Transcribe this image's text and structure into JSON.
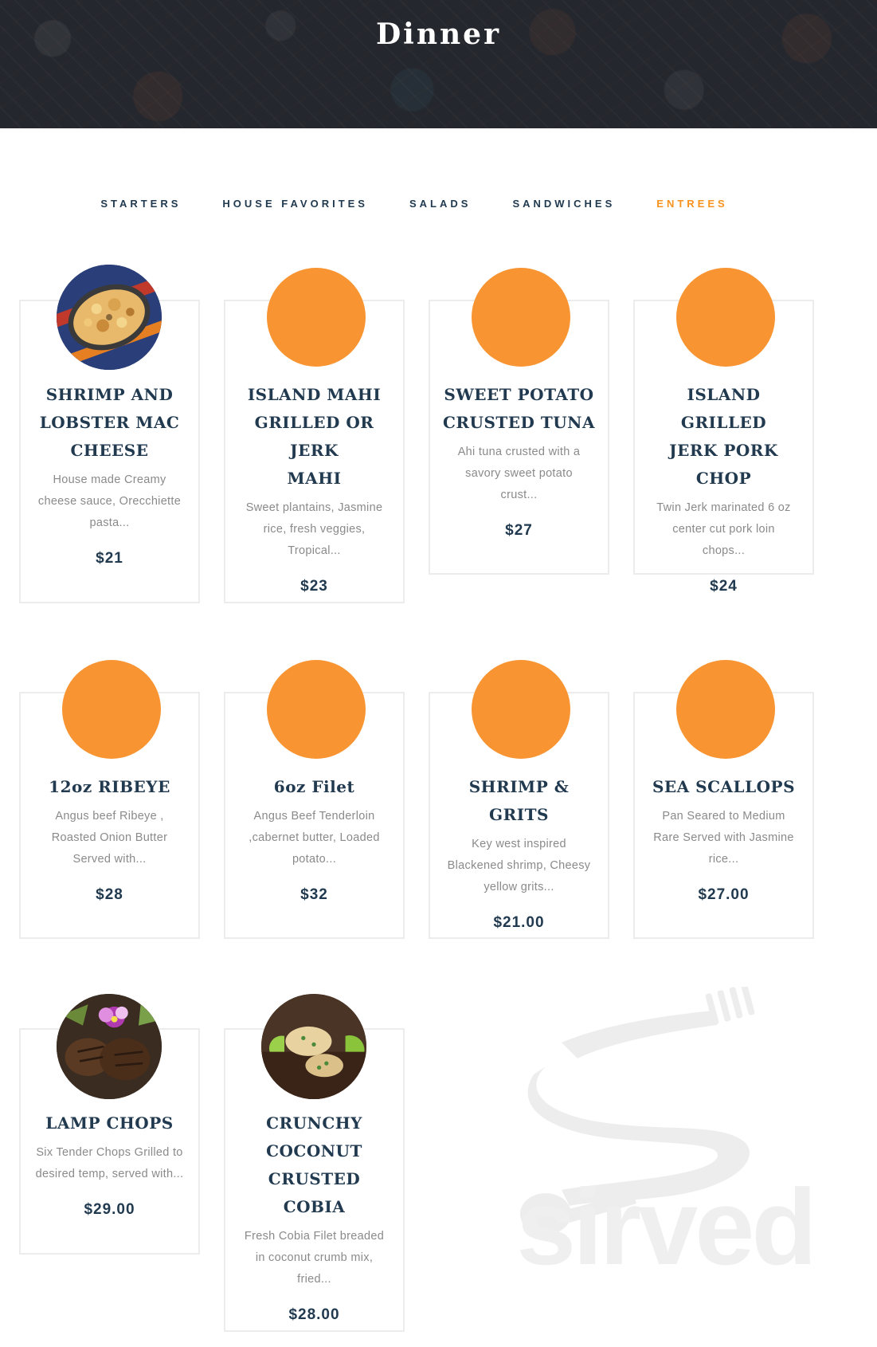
{
  "header": {
    "title": "Dinner"
  },
  "tabs": [
    {
      "label": "STARTERS",
      "active": false
    },
    {
      "label": "HOUSE FAVORITES",
      "active": false
    },
    {
      "label": "SALADS",
      "active": false
    },
    {
      "label": "SANDWICHES",
      "active": false
    },
    {
      "label": "ENTREES",
      "active": true
    }
  ],
  "colors": {
    "accent": "#f7931e",
    "placeholder": "#f89431",
    "text": "#213a4f",
    "muted": "#8a8a8a"
  },
  "items": [
    {
      "title_lines": [
        "SHRIMP AND",
        "LOBSTER MAC",
        "CHEESE"
      ],
      "desc_lines": [
        "House made Creamy",
        "cheese sauce, Orecchiette",
        "pasta..."
      ],
      "price": "$21",
      "image": "mac-cheese-photo"
    },
    {
      "title_lines": [
        "ISLAND MAHI",
        "GRILLED OR JERK",
        "MAHI"
      ],
      "desc_lines": [
        "Sweet plantains, Jasmine",
        "rice, fresh veggies,",
        "Tropical..."
      ],
      "price": "$23",
      "image": "placeholder"
    },
    {
      "title_lines": [
        "SWEET POTATO",
        "CRUSTED TUNA"
      ],
      "desc_lines": [
        "Ahi tuna crusted with a",
        "savory sweet potato",
        "crust..."
      ],
      "price": "$27",
      "image": "placeholder"
    },
    {
      "title_lines": [
        "ISLAND GRILLED",
        "JERK PORK CHOP"
      ],
      "desc_lines": [
        "Twin Jerk marinated 6 oz",
        "center cut pork loin",
        "chops..."
      ],
      "price": "$24",
      "image": "placeholder"
    },
    {
      "title_lines": [
        "12oz RIBEYE"
      ],
      "desc_lines": [
        "Angus beef Ribeye ,",
        "Roasted Onion Butter",
        "Served with..."
      ],
      "price": "$28",
      "image": "placeholder"
    },
    {
      "title_lines": [
        "6oz Filet"
      ],
      "desc_lines": [
        "Angus Beef Tenderloin",
        ",cabernet butter, Loaded",
        "potato..."
      ],
      "price": "$32",
      "image": "placeholder"
    },
    {
      "title_lines": [
        "SHRIMP & GRITS"
      ],
      "desc_lines": [
        "Key west inspired",
        "Blackened shrimp, Cheesy",
        "yellow grits..."
      ],
      "price": "$21.00",
      "image": "placeholder"
    },
    {
      "title_lines": [
        "SEA SCALLOPS"
      ],
      "desc_lines": [
        "Pan Seared to Medium",
        "Rare Served with Jasmine",
        "rice..."
      ],
      "price": "$27.00",
      "image": "placeholder"
    },
    {
      "title_lines": [
        "LAMP CHOPS"
      ],
      "desc_lines": [
        "Six Tender Chops Grilled to",
        "desired temp, served with..."
      ],
      "price": "$29.00",
      "image": "lamb-chops-photo"
    },
    {
      "title_lines": [
        "CRUNCHY",
        "COCONUT",
        "CRUSTED COBIA"
      ],
      "desc_lines": [
        "Fresh Cobia Filet breaded",
        "in coconut crumb mix,",
        "fried..."
      ],
      "price": "$28.00",
      "image": "cobia-photo"
    }
  ],
  "watermark": {
    "text": "sirved",
    "icon": "fork-spoon-s-logo"
  }
}
